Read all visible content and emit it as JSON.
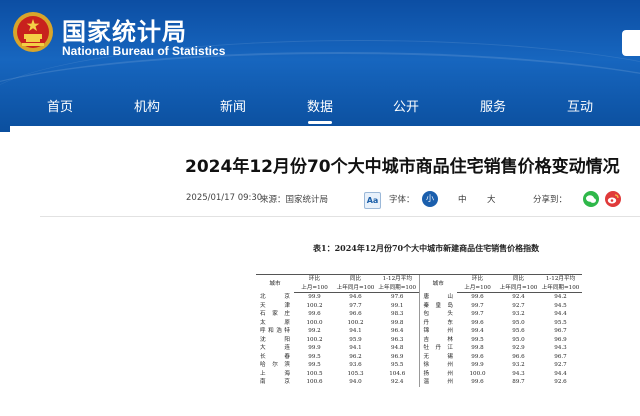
{
  "site": {
    "name_cn": "国家统计局",
    "name_en": "National Bureau of Statistics"
  },
  "nav": [
    {
      "label": "首页",
      "active": false
    },
    {
      "label": "机构",
      "active": false
    },
    {
      "label": "新闻",
      "active": false
    },
    {
      "label": "数据",
      "active": true
    },
    {
      "label": "公开",
      "active": false
    },
    {
      "label": "服务",
      "active": false
    },
    {
      "label": "互动",
      "active": false
    }
  ],
  "article": {
    "title": "2024年12月份70个大中城市商品住宅销售价格变动情况",
    "date": "2025/01/17 09:30",
    "source": "来源：国家统计局",
    "font_label": "字体：",
    "font_icon": "Aa",
    "sizes": [
      "小",
      "中",
      "大"
    ],
    "share_label": "分享到："
  },
  "table": {
    "title": "表1：2024年12月份70个大中城市新建商品住宅销售价格指数",
    "header_city": "城市",
    "groups": [
      "环比",
      "同比",
      "1-12月平均"
    ],
    "subs": [
      "上月=100",
      "上年同月=100",
      "上年同期=100"
    ],
    "left_rows": [
      [
        "北　京",
        "99.9",
        "94.6",
        "97.6"
      ],
      [
        "天　津",
        "100.2",
        "97.7",
        "99.1"
      ],
      [
        "石家庄",
        "99.6",
        "96.6",
        "98.3"
      ],
      [
        "太　原",
        "100.0",
        "100.2",
        "99.8"
      ],
      [
        "呼和浩特",
        "99.2",
        "94.1",
        "96.4"
      ],
      [
        "沈　阳",
        "100.2",
        "95.9",
        "96.3"
      ],
      [
        "大　连",
        "99.9",
        "94.1",
        "94.8"
      ],
      [
        "长　春",
        "99.5",
        "96.2",
        "96.9"
      ],
      [
        "哈尔滨",
        "99.5",
        "93.6",
        "95.5"
      ],
      [
        "上　海",
        "100.5",
        "105.3",
        "104.6"
      ],
      [
        "南　京",
        "100.6",
        "94.0",
        "92.4"
      ]
    ],
    "right_rows": [
      [
        "唐　山",
        "99.6",
        "92.4",
        "94.2"
      ],
      [
        "秦皇岛",
        "99.7",
        "92.7",
        "94.5"
      ],
      [
        "包　头",
        "99.7",
        "93.2",
        "94.4"
      ],
      [
        "丹　东",
        "99.6",
        "95.0",
        "95.5"
      ],
      [
        "锦　州",
        "99.4",
        "95.6",
        "96.7"
      ],
      [
        "吉　林",
        "99.5",
        "95.0",
        "96.9"
      ],
      [
        "牡丹江",
        "99.8",
        "92.9",
        "94.3"
      ],
      [
        "无　锡",
        "99.6",
        "96.6",
        "96.7"
      ],
      [
        "徐　州",
        "99.9",
        "93.2",
        "92.7"
      ],
      [
        "扬　州",
        "100.0",
        "94.3",
        "94.4"
      ],
      [
        "温　州",
        "99.6",
        "89.7",
        "92.6"
      ]
    ]
  },
  "colors": {
    "header_blue": "#1766bf",
    "nav_blue": "#0b4f9e",
    "accent_dark_blue": "#1b5fad",
    "wechat_green": "#2fb84a",
    "weibo_red": "#e03a3a"
  },
  "icons": {
    "logo": "national-emblem-icon",
    "font": "font-size-icon",
    "wechat": "wechat-icon",
    "weibo": "weibo-icon"
  }
}
